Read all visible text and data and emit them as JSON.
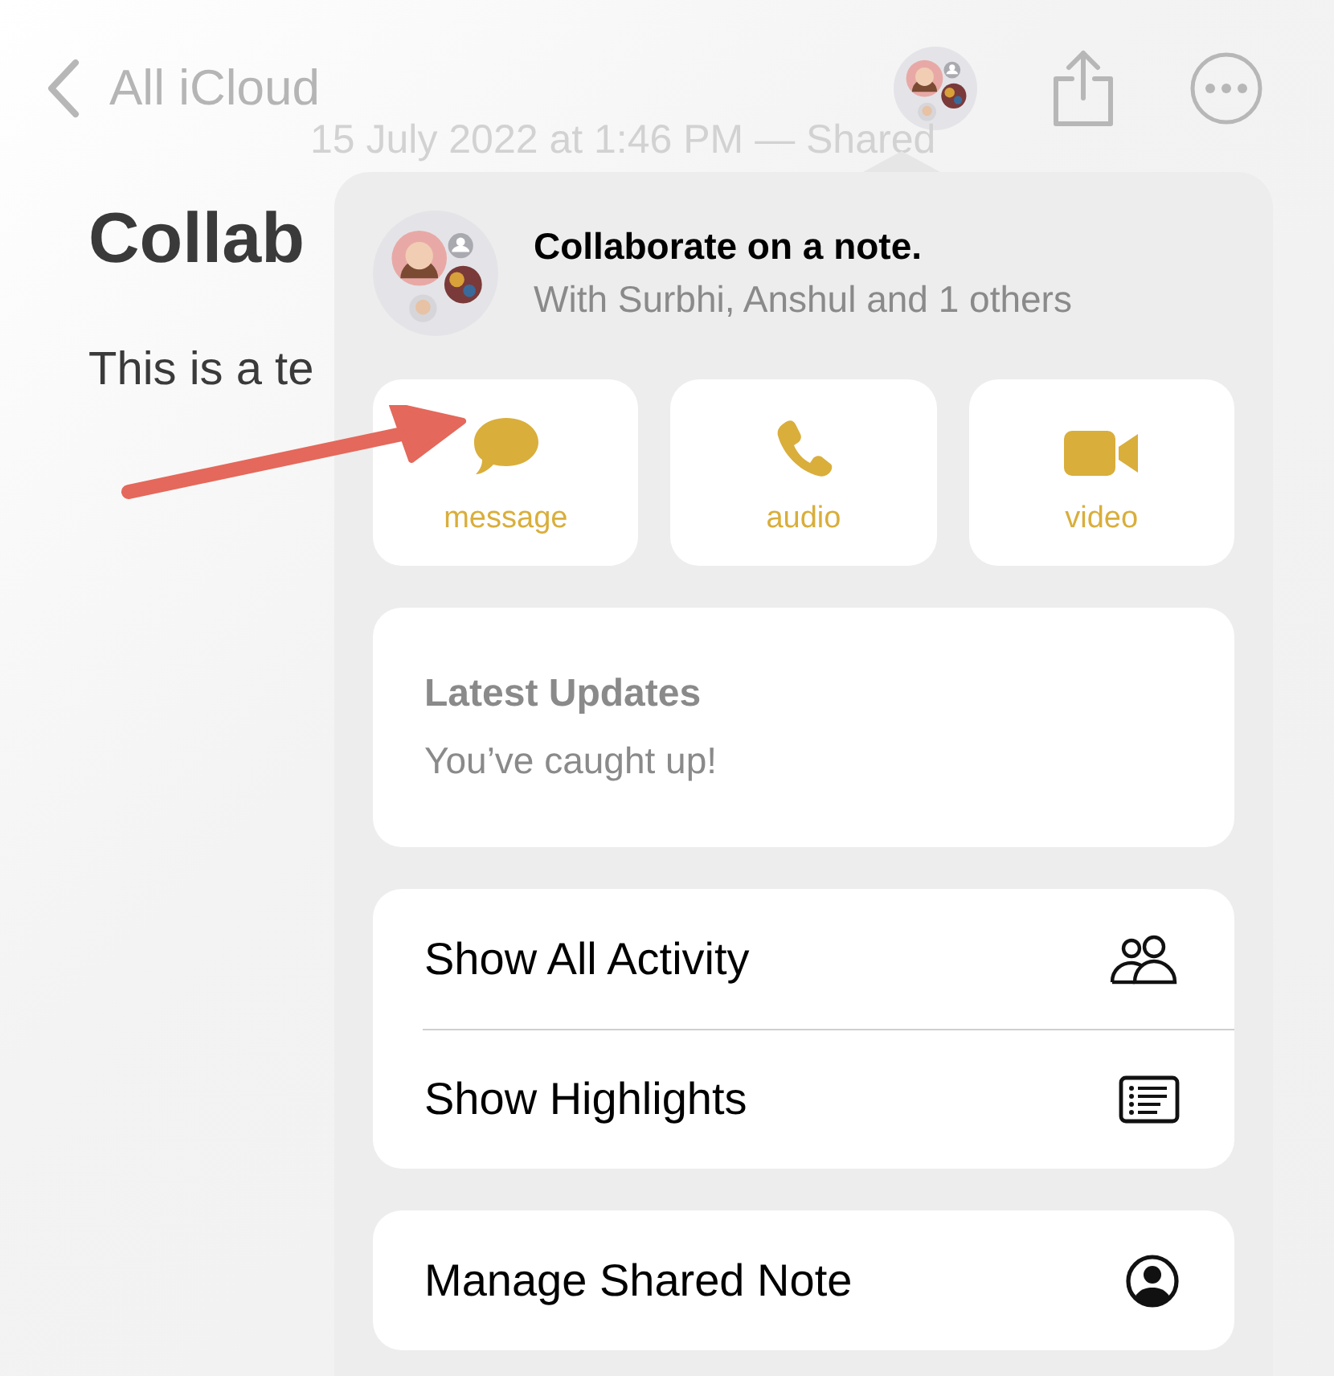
{
  "nav": {
    "back_label": "All iCloud"
  },
  "note": {
    "meta": "15 July 2022 at 1:46 PM — Shared",
    "title": "Collab",
    "body": "This is a te"
  },
  "popover": {
    "title": "Collaborate on a note.",
    "subtitle": "With Surbhi, Anshul and 1 others",
    "actions": [
      {
        "kind": "message",
        "label": "message"
      },
      {
        "kind": "audio",
        "label": "audio"
      },
      {
        "kind": "video",
        "label": "video"
      }
    ],
    "updates": {
      "heading": "Latest Updates",
      "status": "You’ve caught up!"
    },
    "menu_groups": [
      {
        "items": [
          {
            "kind": "people",
            "label": "Show All Activity"
          },
          {
            "kind": "list",
            "label": "Show Highlights"
          }
        ]
      },
      {
        "items": [
          {
            "kind": "person",
            "label": "Manage Shared Note"
          }
        ]
      }
    ]
  }
}
